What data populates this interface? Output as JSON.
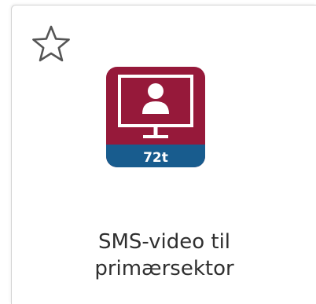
{
  "tile": {
    "title_line1": "SMS-video til",
    "title_line2": "primærsektor",
    "favorite_icon": "star-outline-icon",
    "app_icon": "video-call-monitor-icon",
    "badge_text": "72t"
  },
  "colors": {
    "icon_background": "#96193a",
    "icon_badge": "#185c8e",
    "icon_foreground": "#ffffff",
    "star_stroke": "#555555",
    "text": "#2f2f2f"
  }
}
